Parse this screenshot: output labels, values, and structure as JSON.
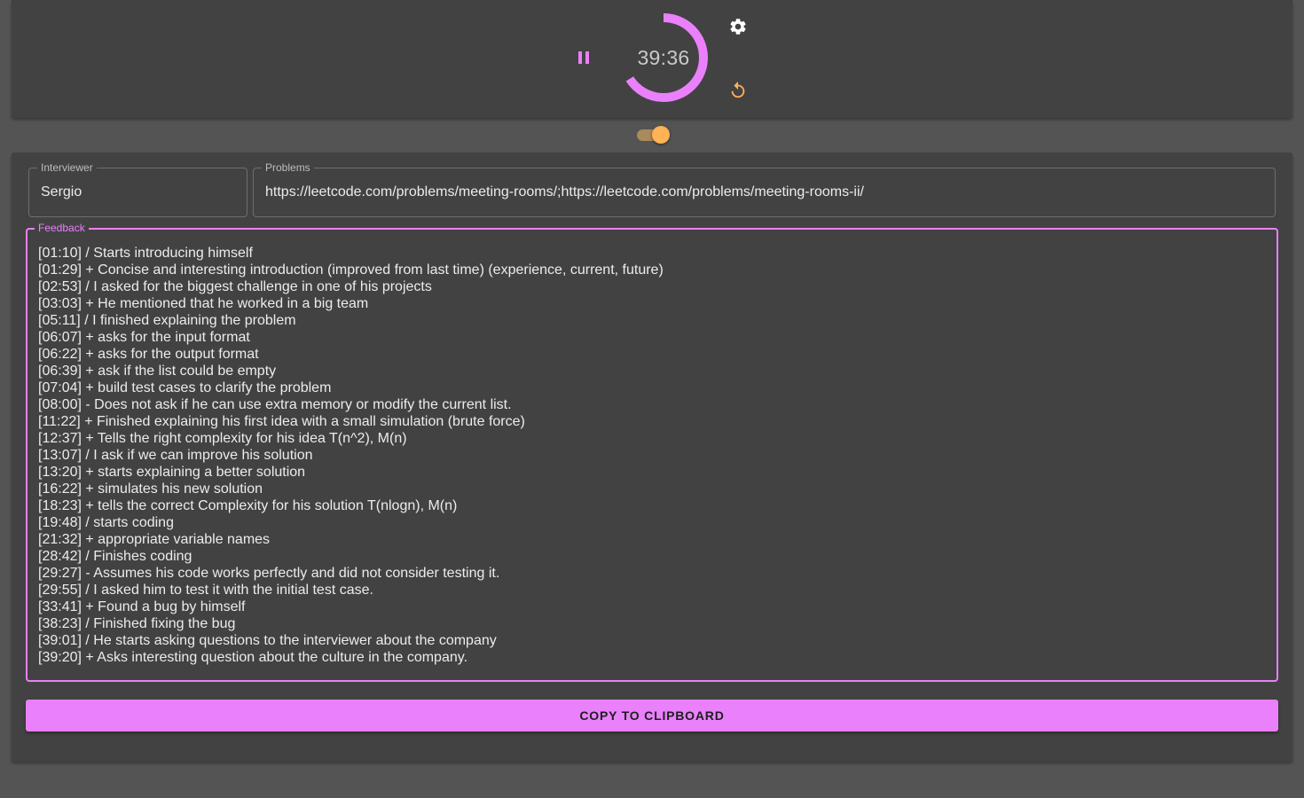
{
  "timer": {
    "time": "39:36",
    "progress_fraction": 0.66,
    "ring_color": "#ea80fc",
    "pause_icon": "pause-icon",
    "settings_icon": "gear-icon",
    "reset_icon": "reset-icon",
    "accent_reset": "#ffb256"
  },
  "toggle": {
    "on": true,
    "color": "#ffb256"
  },
  "form": {
    "interviewer": {
      "label": "Interviewer",
      "value": "Sergio"
    },
    "problems": {
      "label": "Problems",
      "value": "https://leetcode.com/problems/meeting-rooms/;https://leetcode.com/problems/meeting-rooms-ii/"
    },
    "feedback": {
      "label": "Feedback",
      "lines": [
        "[01:10] / Starts introducing himself",
        "[01:29] + Concise and interesting introduction (improved from last time) (experience, current, future)",
        "[02:53] / I asked for the biggest challenge in one of his projects",
        "[03:03] + He mentioned that he worked in a big team",
        "[05:11] / I finished explaining the problem",
        "[06:07] + asks for the input format",
        "[06:22] + asks for the output format",
        "[06:39] + ask if the list could be empty",
        "[07:04] + build test cases to clarify the problem",
        "[08:00] - Does not ask if he can use extra memory or modify the current list.",
        "[11:22] + Finished explaining his first idea with a small simulation (brute force)",
        "[12:37] + Tells the right complexity for his idea T(n^2), M(n)",
        "[13:07] / I ask if we can improve his solution",
        "[13:20] + starts explaining a better solution",
        "[16:22] + simulates his new solution",
        "[18:23] + tells the correct Complexity for his solution T(nlogn), M(n)",
        "[19:48] / starts coding",
        "[21:32] + appropriate variable names",
        "[28:42] / Finishes coding",
        "[29:27] - Assumes his code works perfectly and did not consider testing it.",
        "[29:55] / I asked him to test it with the initial test case.",
        "[33:41] + Found a bug by himself",
        "[38:23] / Finished fixing the bug",
        "[39:01] / He starts asking questions to the interviewer about the company",
        "[39:20] + Asks interesting question about the culture in the company."
      ]
    }
  },
  "copy_button": {
    "label": "COPY TO CLIPBOARD",
    "color": "#ea80fc"
  }
}
